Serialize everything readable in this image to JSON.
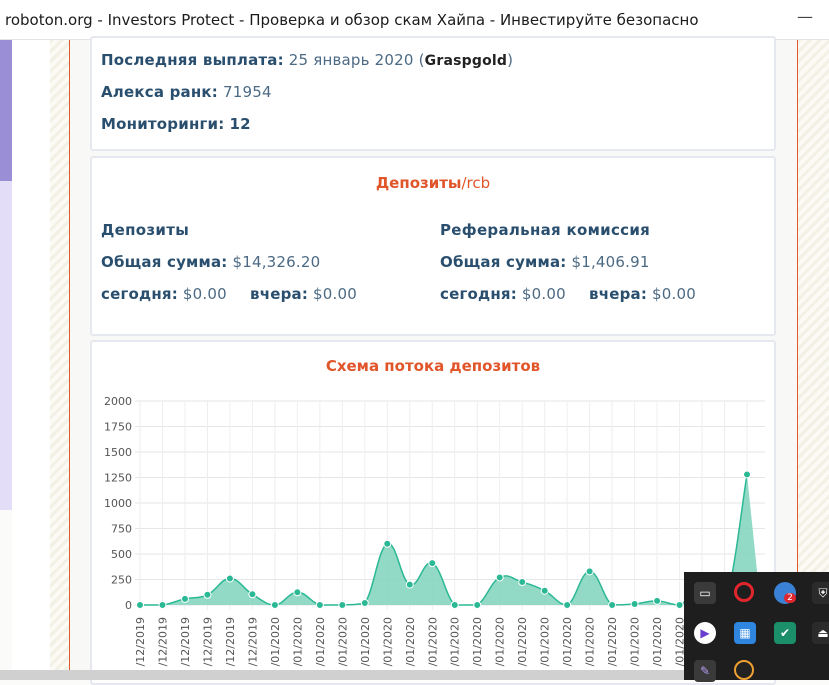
{
  "window": {
    "title": "roboton.org - Investors Protect - Проверка и обзор скам Хайпа - Инвестируйте безопасно",
    "minimize_glyph": "—"
  },
  "info": {
    "last_payout_label": "Последняя выплата:",
    "last_payout_value": "25 январь 2020",
    "last_payout_method": "Graspgold",
    "alexa_label": "Алекса ранк:",
    "alexa_value": "71954",
    "monitorings_label": "Мониторинги:",
    "monitorings_value": "12"
  },
  "deposits": {
    "title": "Депозиты",
    "title_suffix": "/rcb",
    "left": {
      "heading": "Депозиты",
      "total_label": "Общая сумма:",
      "total_value": "$14,326.20",
      "today_label": "сегодня:",
      "today_value": "$0.00",
      "yesterday_label": "вчера:",
      "yesterday_value": "$0.00"
    },
    "right": {
      "heading": "Реферальная комиссия",
      "total_label": "Общая сумма:",
      "total_value": "$1,406.91",
      "today_label": "сегодня:",
      "today_value": "$0.00",
      "yesterday_label": "вчера:",
      "yesterday_value": "$0.00"
    }
  },
  "flow": {
    "title": "Схема потока депозитов"
  },
  "chart_data": {
    "type": "area",
    "title": "Схема потока депозитов",
    "ylim": [
      0,
      2000
    ],
    "yticks": [
      0,
      250,
      500,
      750,
      1000,
      1250,
      1500,
      1750,
      2000
    ],
    "grid": true,
    "color": "#2bb894",
    "fill": "#7fd3bc",
    "x": [
      "/12/2019",
      "/12/2019",
      "/12/2019",
      "/12/2019",
      "/12/2019",
      "/12/2019",
      "/01/2020",
      "/01/2020",
      "/01/2020",
      "/01/2020",
      "/01/2020",
      "/01/2020",
      "/01/2020",
      "/01/2020",
      "/01/2020",
      "/01/2020",
      "/01/2020",
      "/01/2020",
      "/01/2020",
      "/01/2020",
      "/01/2020",
      "/01/2020",
      "/01/2020",
      "/01/2020",
      "/01/2020",
      "/01/2020",
      "/01/2020",
      "/01/2020"
    ],
    "values": [
      0,
      0,
      60,
      100,
      260,
      105,
      0,
      125,
      0,
      0,
      20,
      600,
      200,
      410,
      0,
      0,
      270,
      225,
      140,
      0,
      330,
      0,
      10,
      40,
      0,
      190,
      0,
      1280
    ]
  },
  "tray": {
    "icons": [
      "monitor-icon",
      "opera-icon",
      "chrome-icon",
      "shield-icon",
      "media-icon",
      "network-icon",
      "defender-icon",
      "usb-icon",
      "feather-icon",
      "vpn-icon"
    ],
    "chrome_badge": "2"
  }
}
